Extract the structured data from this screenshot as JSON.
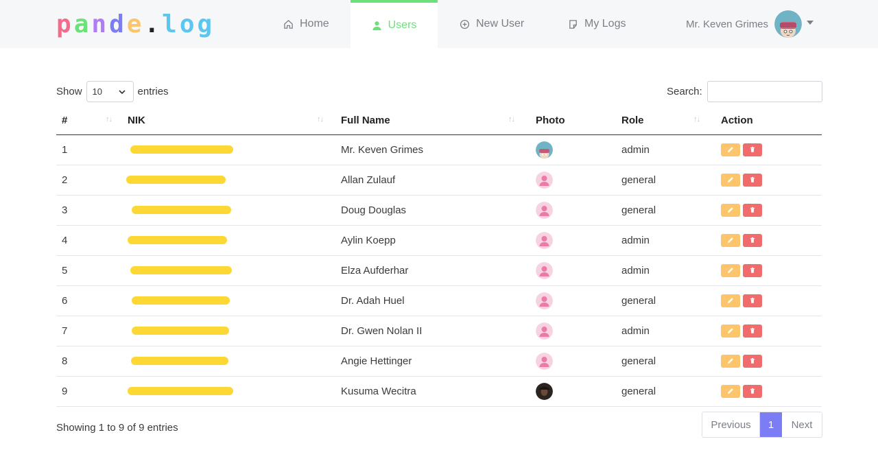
{
  "app": {
    "logo_letters": [
      {
        "ch": "p",
        "color": "#f56b8d"
      },
      {
        "ch": "a",
        "color": "#6ee07a"
      },
      {
        "ch": "n",
        "color": "#b07cf5"
      },
      {
        "ch": "d",
        "color": "#7c7cf5"
      },
      {
        "ch": "e",
        "color": "#fcc56b"
      },
      {
        "ch": ".",
        "color": "#222222"
      },
      {
        "ch": "l",
        "color": "#5bc6f0"
      },
      {
        "ch": "o",
        "color": "#5bc6f0"
      },
      {
        "ch": "g",
        "color": "#5bc6f0"
      }
    ]
  },
  "nav": {
    "home": "Home",
    "users": "Users",
    "new_user": "New User",
    "my_logs": "My Logs",
    "user_name": "Mr. Keven Grimes"
  },
  "controls": {
    "show_label": "Show",
    "entries_value": "10",
    "entries_label": "entries",
    "search_label": "Search:",
    "search_value": ""
  },
  "table": {
    "columns": [
      "#",
      "NIK",
      "Full Name",
      "Photo",
      "Role",
      "Action"
    ],
    "rows": [
      {
        "num": "1",
        "name": "Mr. Keven Grimes",
        "role": "admin",
        "photo": "avatar-cartoon"
      },
      {
        "num": "2",
        "name": "Allan Zulauf",
        "role": "general",
        "photo": "avatar-default"
      },
      {
        "num": "3",
        "name": "Doug Douglas",
        "role": "general",
        "photo": "avatar-default"
      },
      {
        "num": "4",
        "name": "Aylin Koepp",
        "role": "admin",
        "photo": "avatar-default"
      },
      {
        "num": "5",
        "name": "Elza Aufderhar",
        "role": "admin",
        "photo": "avatar-default"
      },
      {
        "num": "6",
        "name": "Dr. Adah Huel",
        "role": "general",
        "photo": "avatar-default"
      },
      {
        "num": "7",
        "name": "Dr. Gwen Nolan II",
        "role": "admin",
        "photo": "avatar-default"
      },
      {
        "num": "8",
        "name": "Angie Hettinger",
        "role": "general",
        "photo": "avatar-default"
      },
      {
        "num": "9",
        "name": "Kusuma Wecitra",
        "role": "general",
        "photo": "avatar-photo-dark"
      }
    ]
  },
  "footer": {
    "info": "Showing 1 to 9 of 9 entries",
    "prev": "Previous",
    "page": "1",
    "next": "Next"
  },
  "colors": {
    "accent_green": "#6ee07a",
    "pager_active": "#7c7cf5",
    "edit": "#fcc56b",
    "delete": "#f06b6b",
    "redaction": "#fdd835"
  }
}
